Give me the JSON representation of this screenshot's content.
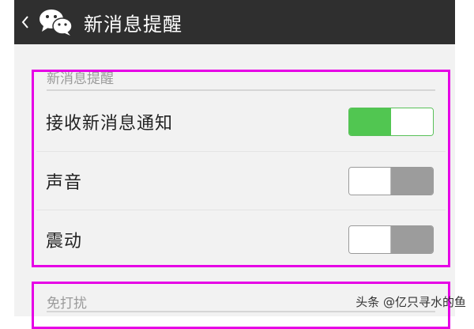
{
  "header": {
    "title": "新消息提醒",
    "background_color": "#2f2f2f"
  },
  "sections": [
    {
      "title": "新消息提醒",
      "items": [
        {
          "label": "接收新消息通知",
          "toggle_on": true
        },
        {
          "label": "声音",
          "toggle_on": false
        },
        {
          "label": "震动",
          "toggle_on": false
        }
      ]
    },
    {
      "title": "免打扰"
    }
  ],
  "highlight_color": "#e600e6",
  "toggle_on_color": "#51c651",
  "toggle_off_color": "#9c9c9c",
  "watermark": "头条 @亿只寻水的鱼"
}
